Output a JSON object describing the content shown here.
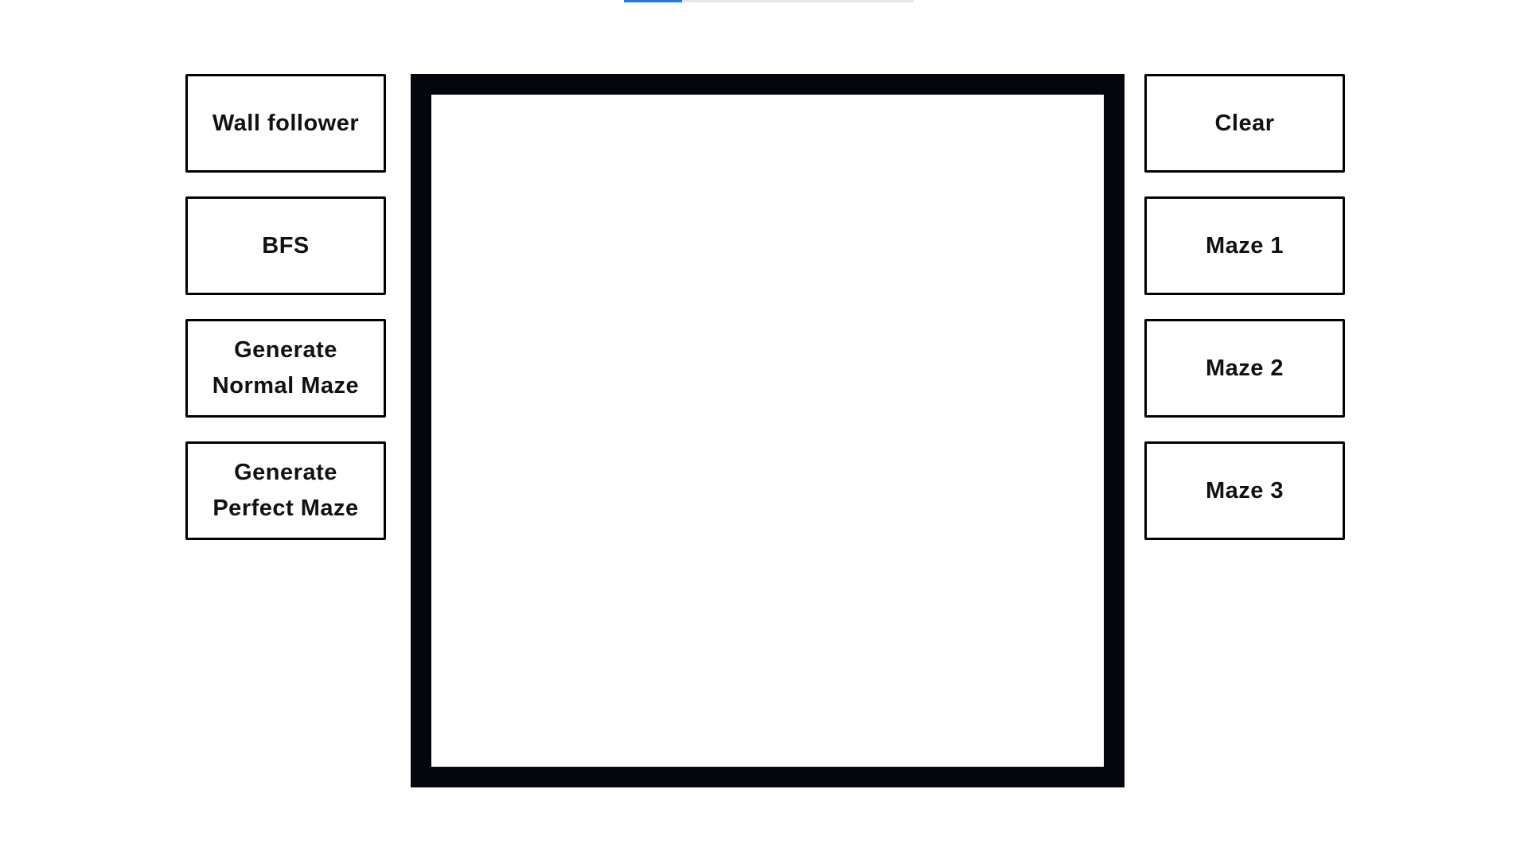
{
  "progress": {
    "fraction": 0.2,
    "color": "#1f7ae0"
  },
  "left_buttons": [
    {
      "label": "Wall follower"
    },
    {
      "label": "BFS"
    },
    {
      "label": "Generate\nNormal Maze"
    },
    {
      "label": "Generate\nPerfect Maze"
    }
  ],
  "right_buttons": [
    {
      "label": "Clear"
    },
    {
      "label": "Maze 1"
    },
    {
      "label": "Maze 2"
    },
    {
      "label": "Maze 3"
    }
  ],
  "colors": {
    "maze_border": "#04050d",
    "button_border": "#000000",
    "background": "#ffffff"
  }
}
